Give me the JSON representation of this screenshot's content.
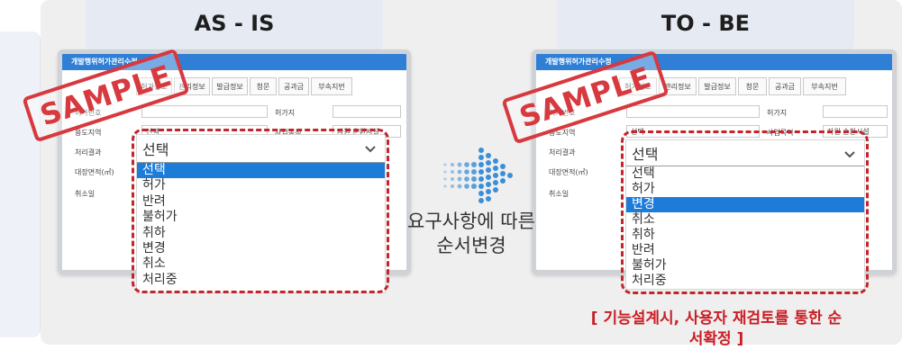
{
  "headers": {
    "as_is": "AS - IS",
    "to_be": "TO - BE"
  },
  "stamp": "SAMPLE",
  "left_screen": {
    "title": "개발행위허가관리수정",
    "tabs": [
      "허가정보",
      "관리정보",
      "발급정보",
      "청문",
      "공과금",
      "부속지번"
    ],
    "rows": [
      {
        "label": "허가번호",
        "value": ""
      },
      {
        "label": "용도지역",
        "value": "선택"
      },
      {
        "label": "처리결과",
        "value": ""
      },
      {
        "label": "대장면적(㎡)",
        "value": ""
      },
      {
        "label": "취소일",
        "value": ""
      }
    ],
    "right_labels": [
      "허가지",
      "사업목적"
    ],
    "right_values": [
      "",
      "자원 순환시설"
    ],
    "combo_value": "선택",
    "options": [
      "선택",
      "허가",
      "반려",
      "불허가",
      "취하",
      "변경",
      "취소",
      "처리중"
    ],
    "selected_index": 0
  },
  "right_screen": {
    "title": "개발행위허가관리수정",
    "tabs": [
      "허가정보",
      "관리정보",
      "발급정보",
      "청문",
      "공과금",
      "부속지번"
    ],
    "rows": [
      {
        "label": "허가번호",
        "value": ""
      },
      {
        "label": "용도지역",
        "value": "선택"
      },
      {
        "label": "처리결과",
        "value": ""
      },
      {
        "label": "대장면적(㎡)",
        "value": ""
      },
      {
        "label": "취소일",
        "value": ""
      }
    ],
    "right_labels": [
      "허가지",
      "사업목적"
    ],
    "right_values": [
      "",
      "자원 순환시설"
    ],
    "combo_value": "선택",
    "options": [
      "선택",
      "허가",
      "변경",
      "취소",
      "취하",
      "반려",
      "불허가",
      "처리중"
    ],
    "selected_index": 2
  },
  "middle": {
    "line1": "요구사항에 따른",
    "line2": "순서변경"
  },
  "note": {
    "line1": "[ 기능설계시, 사용자 재검토를 통한 순",
    "line2": "서확정 ]"
  },
  "colors": {
    "accent_blue": "#1e7cd9",
    "highlight_red": "#c3252b",
    "header_blue": "#2f7fd6"
  }
}
